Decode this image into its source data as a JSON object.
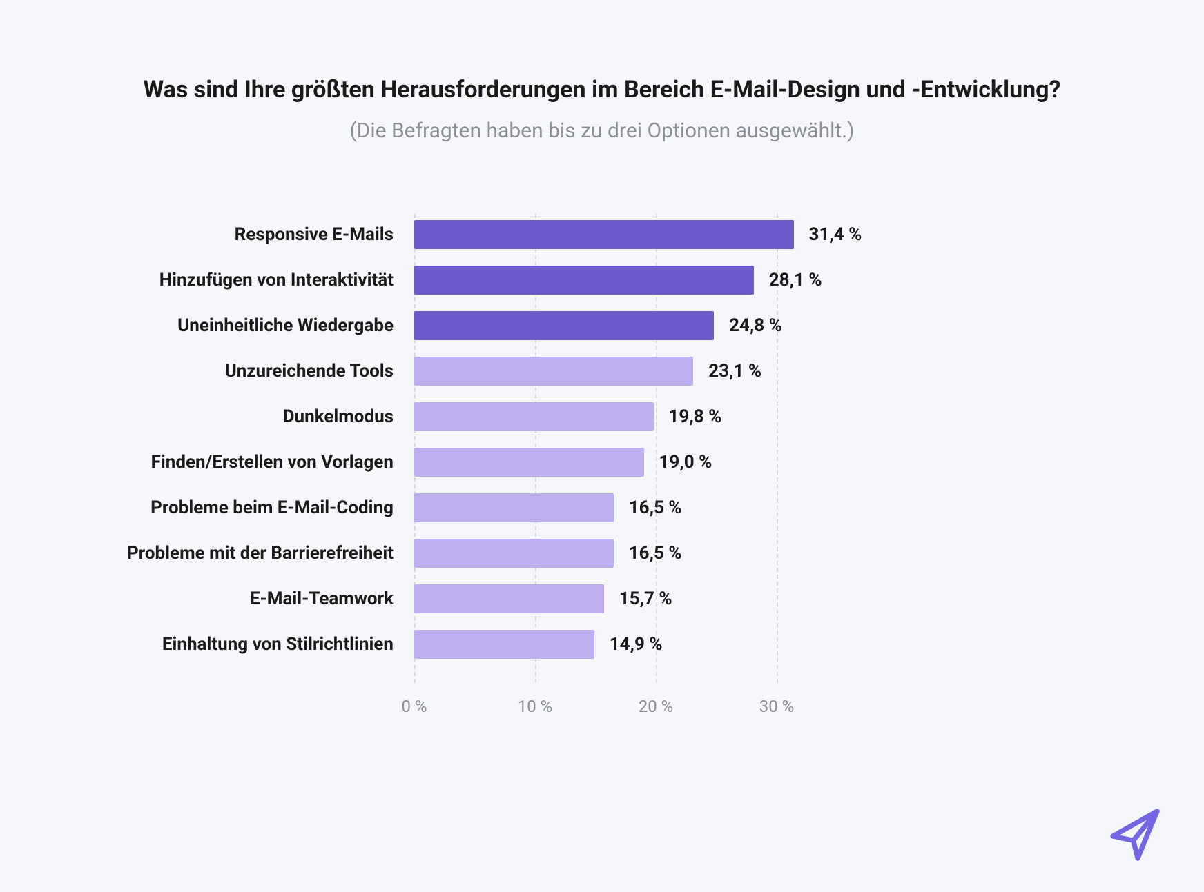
{
  "title": "Was sind Ihre größten Herausforderungen im Bereich E-Mail-Design und -Entwicklung?",
  "subtitle": "(Die Befragten haben bis zu drei Optionen ausgewählt.)",
  "x_ticks": [
    "0 %",
    "10 %",
    "20 %",
    "30 %"
  ],
  "colors": {
    "dark": "#6b5acb",
    "light": "#beaff0"
  },
  "logo_color": "#7466e3",
  "chart_data": {
    "type": "bar",
    "orientation": "horizontal",
    "xlim": [
      0,
      40
    ],
    "xlabel": "",
    "ylabel": "",
    "title": "Was sind Ihre größten Herausforderungen im Bereich E-Mail-Design und -Entwicklung?",
    "categories": [
      "Responsive E-Mails",
      "Hinzufügen von Interaktivität",
      "Uneinheitliche Wiedergabe",
      "Unzureichende Tools",
      "Dunkelmodus",
      "Finden/Erstellen von Vorlagen",
      "Probleme beim E-Mail-Coding",
      "Probleme mit der Barrierefreiheit",
      "E-Mail-Teamwork",
      "Einhaltung von Stilrichtlinien"
    ],
    "values": [
      31.4,
      28.1,
      24.8,
      23.1,
      19.8,
      19.0,
      16.5,
      16.5,
      15.7,
      14.9
    ],
    "value_labels": [
      "31,4 %",
      "28,1 %",
      "24,8 %",
      "23,1 %",
      "19,8 %",
      "19,0 %",
      "16,5 %",
      "16,5 %",
      "15,7 %",
      "14,9 %"
    ],
    "emphasis": [
      true,
      true,
      true,
      false,
      false,
      false,
      false,
      false,
      false,
      false
    ],
    "x_ticks": [
      0,
      10,
      20,
      30
    ]
  }
}
